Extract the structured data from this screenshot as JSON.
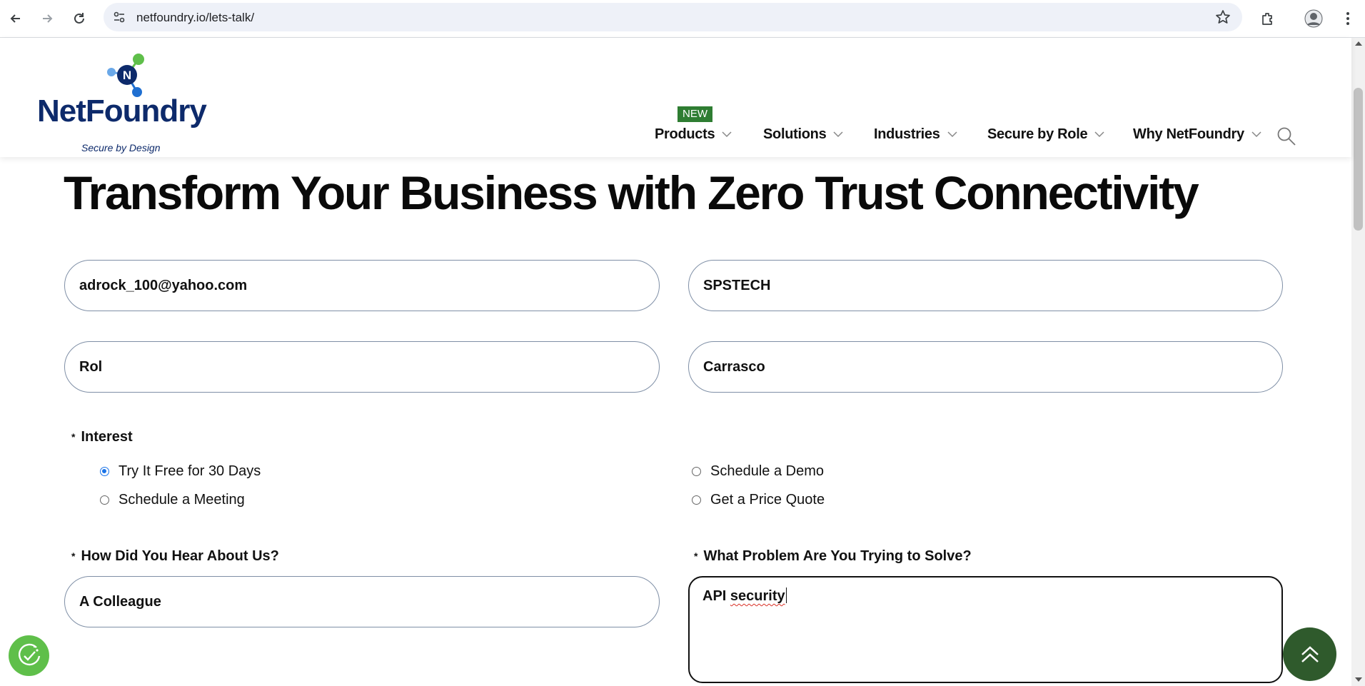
{
  "browser": {
    "url": "netfoundry.io/lets-talk/",
    "icons": [
      "back-arrow-icon",
      "forward-arrow-icon",
      "reload-icon",
      "site-settings-icon",
      "bookmark-star-icon",
      "extensions-icon",
      "profile-avatar-icon",
      "more-menu-icon"
    ]
  },
  "header": {
    "logo_text": "NetFoundry",
    "logo_tagline": "Secure by Design",
    "new_badge": "NEW",
    "nav": [
      {
        "label": "Products"
      },
      {
        "label": "Solutions"
      },
      {
        "label": "Industries"
      },
      {
        "label": "Secure by Role"
      },
      {
        "label": "Why NetFoundry"
      }
    ]
  },
  "page": {
    "title": "Transform Your Business with Zero Trust Connectivity",
    "form": {
      "email": "adrock_100@yahoo.com",
      "company": "SPSTECH",
      "first_name": "Rol",
      "last_name": "Carrasco",
      "required_marker": "*",
      "interest_label": "Interest",
      "interest_options": [
        {
          "label": "Try It Free for 30 Days",
          "selected": true
        },
        {
          "label": "Schedule a Demo",
          "selected": false
        },
        {
          "label": "Schedule a Meeting",
          "selected": false
        },
        {
          "label": "Get a Price Quote",
          "selected": false
        }
      ],
      "hear_label": "How Did You Hear About Us?",
      "hear_value": "A Colleague",
      "problem_label": "What Problem Are You Trying to Solve?",
      "problem_value_word1": "API",
      "problem_value_word2": "security"
    }
  },
  "colors": {
    "brand_navy": "#0d2a6b",
    "badge_green": "#2e7d32",
    "fab_green": "#2f5a2c",
    "cookie_green": "#5fbf4a",
    "radio_blue": "#1a73e8"
  }
}
